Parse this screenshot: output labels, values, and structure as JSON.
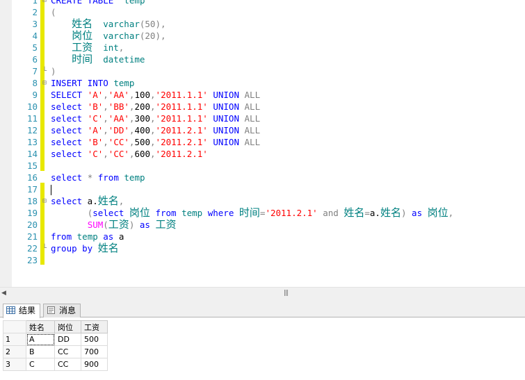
{
  "editor": {
    "lines": [
      {
        "no": "1",
        "segs": [
          [
            "kw",
            "CREATE TABLE"
          ],
          [
            "",
            "  "
          ],
          [
            "cm",
            "temp"
          ]
        ]
      },
      {
        "no": "2",
        "segs": [
          [
            "gr",
            "("
          ]
        ]
      },
      {
        "no": "3",
        "segs": [
          [
            "",
            "    "
          ],
          [
            "cjk-cm",
            "姓名"
          ],
          [
            "",
            ""
          ],
          [
            "",
            "  "
          ],
          [
            "cm",
            "varchar"
          ],
          [
            "gr",
            "(50),"
          ]
        ]
      },
      {
        "no": "4",
        "segs": [
          [
            "",
            "    "
          ],
          [
            "cjk-cm",
            "岗位"
          ],
          [
            "",
            "  "
          ],
          [
            "cm",
            "varchar"
          ],
          [
            "gr",
            "(20),"
          ]
        ]
      },
      {
        "no": "5",
        "segs": [
          [
            "",
            "    "
          ],
          [
            "cjk-cm",
            "工资"
          ],
          [
            "",
            "  "
          ],
          [
            "cm",
            "int"
          ],
          [
            "gr",
            ","
          ]
        ]
      },
      {
        "no": "6",
        "segs": [
          [
            "",
            "    "
          ],
          [
            "cjk-cm",
            "时间"
          ],
          [
            "",
            "  "
          ],
          [
            "cm",
            "datetime"
          ]
        ]
      },
      {
        "no": "7",
        "segs": [
          [
            "gr",
            ")"
          ]
        ]
      },
      {
        "no": "8",
        "segs": [
          [
            "kw",
            "INSERT INTO"
          ],
          [
            "",
            " "
          ],
          [
            "cm",
            "temp"
          ]
        ]
      },
      {
        "no": "9",
        "segs": [
          [
            "kw",
            "SELECT"
          ],
          [
            "",
            " "
          ],
          [
            "st",
            "'A'"
          ],
          [
            "gr",
            ","
          ],
          [
            "st",
            "'AA'"
          ],
          [
            "gr",
            ","
          ],
          [
            "",
            "100"
          ],
          [
            "gr",
            ","
          ],
          [
            "st",
            "'2011.1.1'"
          ],
          [
            "",
            " "
          ],
          [
            "kw",
            "UNION"
          ],
          [
            "",
            " "
          ],
          [
            "gr",
            "ALL"
          ]
        ]
      },
      {
        "no": "10",
        "segs": [
          [
            "kw",
            "select"
          ],
          [
            "",
            " "
          ],
          [
            "st",
            "'B'"
          ],
          [
            "gr",
            ","
          ],
          [
            "st",
            "'BB'"
          ],
          [
            "gr",
            ","
          ],
          [
            "",
            "200"
          ],
          [
            "gr",
            ","
          ],
          [
            "st",
            "'2011.1.1'"
          ],
          [
            "",
            " "
          ],
          [
            "kw",
            "UNION"
          ],
          [
            "",
            " "
          ],
          [
            "gr",
            "ALL"
          ]
        ]
      },
      {
        "no": "11",
        "segs": [
          [
            "kw",
            "select"
          ],
          [
            "",
            " "
          ],
          [
            "st",
            "'C'"
          ],
          [
            "gr",
            ","
          ],
          [
            "st",
            "'AA'"
          ],
          [
            "gr",
            ","
          ],
          [
            "",
            "300"
          ],
          [
            "gr",
            ","
          ],
          [
            "st",
            "'2011.1.1'"
          ],
          [
            "",
            " "
          ],
          [
            "kw",
            "UNION"
          ],
          [
            "",
            " "
          ],
          [
            "gr",
            "ALL"
          ]
        ]
      },
      {
        "no": "12",
        "segs": [
          [
            "kw",
            "select"
          ],
          [
            "",
            " "
          ],
          [
            "st",
            "'A'"
          ],
          [
            "gr",
            ","
          ],
          [
            "st",
            "'DD'"
          ],
          [
            "gr",
            ","
          ],
          [
            "",
            "400"
          ],
          [
            "gr",
            ","
          ],
          [
            "st",
            "'2011.2.1'"
          ],
          [
            "",
            " "
          ],
          [
            "kw",
            "UNION"
          ],
          [
            "",
            " "
          ],
          [
            "gr",
            "ALL"
          ]
        ]
      },
      {
        "no": "13",
        "segs": [
          [
            "kw",
            "select"
          ],
          [
            "",
            " "
          ],
          [
            "st",
            "'B'"
          ],
          [
            "gr",
            ","
          ],
          [
            "st",
            "'CC'"
          ],
          [
            "gr",
            ","
          ],
          [
            "",
            "500"
          ],
          [
            "gr",
            ","
          ],
          [
            "st",
            "'2011.2.1'"
          ],
          [
            "",
            " "
          ],
          [
            "kw",
            "UNION"
          ],
          [
            "",
            " "
          ],
          [
            "gr",
            "ALL"
          ]
        ]
      },
      {
        "no": "14",
        "segs": [
          [
            "kw",
            "select"
          ],
          [
            "",
            " "
          ],
          [
            "st",
            "'C'"
          ],
          [
            "gr",
            ","
          ],
          [
            "st",
            "'CC'"
          ],
          [
            "gr",
            ","
          ],
          [
            "",
            "600"
          ],
          [
            "gr",
            ","
          ],
          [
            "st",
            "'2011.2.1'"
          ]
        ]
      },
      {
        "no": "15",
        "segs": []
      },
      {
        "no": "16",
        "segs": [
          [
            "kw",
            "select"
          ],
          [
            "",
            " "
          ],
          [
            "gr",
            "*"
          ],
          [
            "",
            " "
          ],
          [
            "kw",
            "from"
          ],
          [
            "",
            " "
          ],
          [
            "cm",
            "temp"
          ]
        ]
      },
      {
        "no": "17",
        "segs": [
          [
            "caret",
            ""
          ]
        ]
      },
      {
        "no": "18",
        "segs": [
          [
            "kw",
            "select"
          ],
          [
            "",
            " a."
          ],
          [
            "cjk-cm",
            "姓名"
          ],
          [
            "gr",
            ","
          ]
        ]
      },
      {
        "no": "19",
        "segs": [
          [
            "",
            "       "
          ],
          [
            "gr",
            "("
          ],
          [
            "kw",
            "select"
          ],
          [
            "",
            " "
          ],
          [
            "cjk-cm",
            "岗位"
          ],
          [
            "",
            " "
          ],
          [
            "kw",
            "from"
          ],
          [
            "",
            " "
          ],
          [
            "cm",
            "temp"
          ],
          [
            "",
            " "
          ],
          [
            "kw",
            "where"
          ],
          [
            "",
            " "
          ],
          [
            "cjk-cm",
            "时间"
          ],
          [
            "gr",
            "="
          ],
          [
            "st",
            "'2011.2.1'"
          ],
          [
            "",
            " "
          ],
          [
            "gr",
            "and"
          ],
          [
            "",
            " "
          ],
          [
            "cjk-cm",
            "姓名"
          ],
          [
            "gr",
            "="
          ],
          [
            "",
            "a."
          ],
          [
            "cjk-cm",
            "姓名"
          ],
          [
            "gr",
            ")"
          ],
          [
            "",
            " "
          ],
          [
            "kw",
            "as"
          ],
          [
            "",
            " "
          ],
          [
            "cjk-cm",
            "岗位"
          ],
          [
            "gr",
            ","
          ]
        ]
      },
      {
        "no": "20",
        "segs": [
          [
            "",
            "       "
          ],
          [
            "fn",
            "SUM"
          ],
          [
            "gr",
            "("
          ],
          [
            "cjk-cm",
            "工资"
          ],
          [
            "gr",
            ")"
          ],
          [
            "",
            " "
          ],
          [
            "kw",
            "as"
          ],
          [
            "",
            " "
          ],
          [
            "cjk-cm",
            "工资"
          ]
        ]
      },
      {
        "no": "21",
        "segs": [
          [
            "kw",
            "from"
          ],
          [
            "",
            " "
          ],
          [
            "cm",
            "temp"
          ],
          [
            "",
            " "
          ],
          [
            "kw",
            "as"
          ],
          [
            "",
            " "
          ],
          [
            "",
            "a"
          ]
        ]
      },
      {
        "no": "22",
        "segs": [
          [
            "kw",
            "group by"
          ],
          [
            "",
            " "
          ],
          [
            "cjk-cm",
            "姓名"
          ]
        ]
      },
      {
        "no": "23",
        "segs": []
      }
    ]
  },
  "tabs": {
    "results": "结果",
    "messages": "消息"
  },
  "grid": {
    "headers": [
      "姓名",
      "岗位",
      "工资"
    ],
    "rows": [
      {
        "n": "1",
        "c": [
          "A",
          "DD",
          "500"
        ]
      },
      {
        "n": "2",
        "c": [
          "B",
          "CC",
          "700"
        ]
      },
      {
        "n": "3",
        "c": [
          "C",
          "CC",
          "900"
        ]
      }
    ]
  },
  "colors": {
    "keyword": "#0000ff",
    "string": "#ff0000",
    "gray": "#808080",
    "function": "#ff00ff",
    "lineNumber": "#2b91af",
    "changeMarker": "#e8e800"
  }
}
